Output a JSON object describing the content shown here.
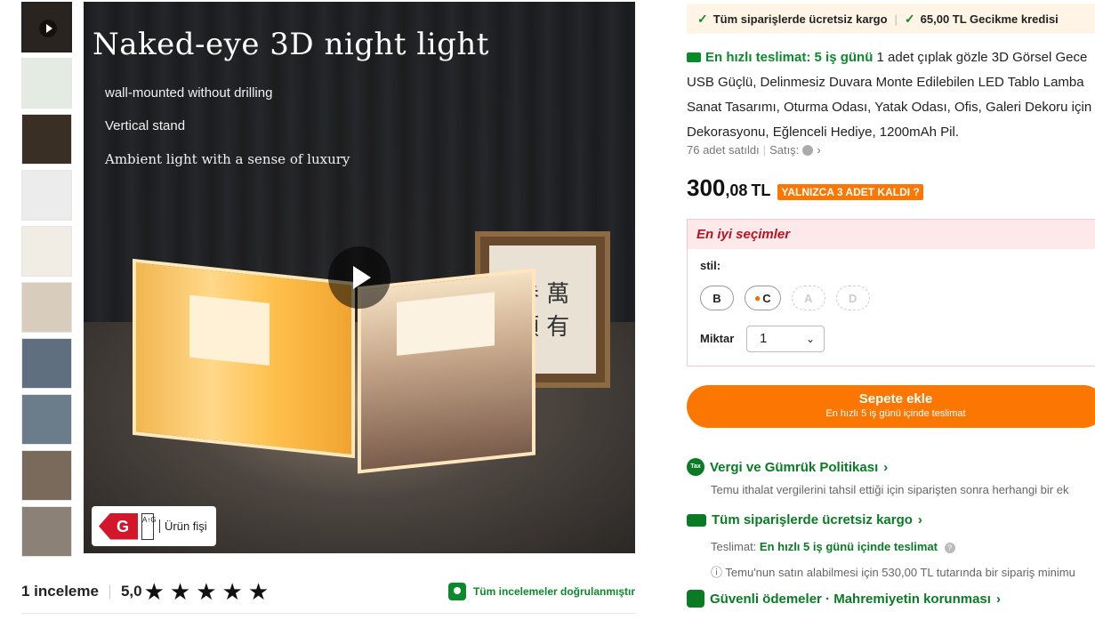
{
  "thumbnails": [
    {
      "bg": "#2a2420",
      "video": true
    },
    {
      "bg": "#e4ebe2",
      "video": false
    },
    {
      "bg": "#3a2f25",
      "video": false
    },
    {
      "bg": "#ececec",
      "video": false
    },
    {
      "bg": "#f1ece4",
      "video": false
    },
    {
      "bg": "#d8cdbd",
      "video": false
    },
    {
      "bg": "#5f6f7f",
      "video": false
    },
    {
      "bg": "#6b7d8b",
      "video": false
    },
    {
      "bg": "#7a6a5c",
      "video": false
    },
    {
      "bg": "#8b8176",
      "video": false
    }
  ],
  "hero": {
    "title": "Naked-eye 3D night light",
    "features": [
      "wall-mounted without drilling",
      "Vertical stand",
      "Ambient light with a sense of luxury"
    ],
    "energy_class": "G",
    "energy_scale": "A↑G",
    "energy_label": "Ürün fişi"
  },
  "reviews": {
    "count_label": "1 inceleme",
    "score": "5,0",
    "stars": [
      "★",
      "★",
      "★",
      "★",
      "★"
    ],
    "verified_label": "Tüm incelemeler doğrulanmıştır"
  },
  "shipping_strip": {
    "item1": "Tüm siparişlerde ücretsiz kargo",
    "item2": "65,00 TL Gecikme kredisi"
  },
  "product": {
    "fast_label": "En hızlı teslimat: 5 iş günü",
    "desc_line1": "1 adet çıplak gözle 3D Görsel Gece",
    "desc_line2": "USB Güçlü, Delinmesiz Duvara Monte Edilebilen LED Tablo Lamba",
    "desc_line3": "Sanat Tasarımı, Oturma Odası, Yatak Odası, Ofis, Galeri Dekoru için",
    "desc_line4": "Dekorasyonu, Eğlenceli Hediye, 1200mAh Pil.",
    "sold": "76 adet satıldı",
    "seller_label": "Satış:",
    "price_main": "300",
    "price_dec": ",08",
    "currency": "TL",
    "stock_badge": "YALNIZCA 3 ADET KALDI"
  },
  "options": {
    "header": "En iyi seçimler",
    "style_label": "stil:",
    "styles": [
      {
        "label": "B",
        "disabled": false,
        "fire": false
      },
      {
        "label": "C",
        "disabled": false,
        "fire": true
      },
      {
        "label": "A",
        "disabled": true,
        "fire": false
      },
      {
        "label": "D",
        "disabled": true,
        "fire": false
      }
    ],
    "qty_label": "Miktar",
    "qty_value": "1"
  },
  "cta": {
    "label": "Sepete ekle",
    "sub": "En hızlı 5 iş günü içinde teslimat"
  },
  "policies": {
    "tax_icon": "Tax",
    "tax_title": "Vergi ve Gümrük Politikası",
    "tax_text": "Temu ithalat vergilerini tahsil ettiği için siparişten sonra herhangi bir ek",
    "ship_title": "Tüm siparişlerde ücretsiz kargo",
    "ship_label": "Teslimat:",
    "ship_value": "En hızlı 5 iş günü içinde teslimat",
    "ship_note": "Temu'nun satın alabilmesi için 530,00 TL tutarında bir sipariş minimu",
    "secure_title": "Güvenli ödemeler · Mahremiyetin korunması"
  },
  "colors": {
    "accent": "#fb7701",
    "green": "#0a7b24",
    "box_header_bg": "#fde9ea",
    "box_header_text": "#b41525"
  }
}
